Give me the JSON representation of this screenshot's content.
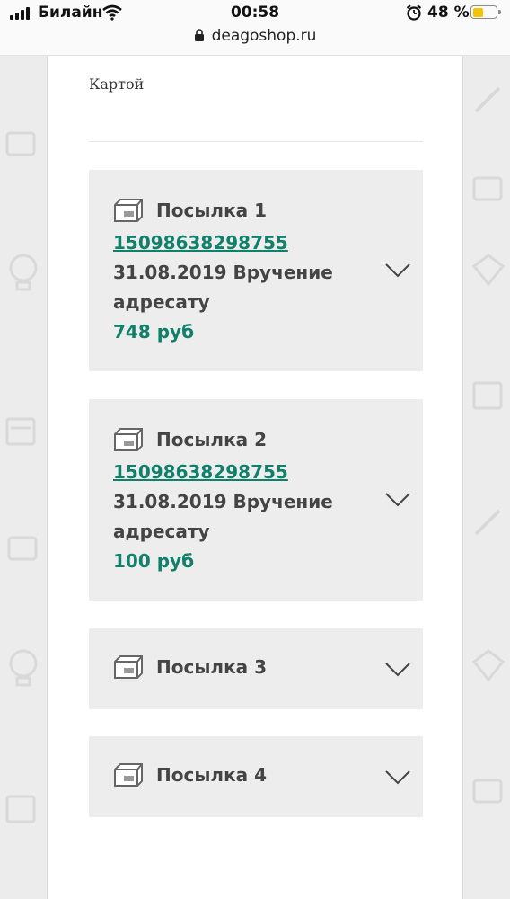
{
  "status_bar": {
    "carrier": "Билайн",
    "time": "00:58",
    "battery_percent": "48 %",
    "battery_level": 0.48,
    "url": "deagoshop.ru"
  },
  "payment": {
    "method_label": "Картой"
  },
  "parcels": [
    {
      "title": "Посылка 1",
      "tracking": "15098638298755",
      "status_line1": "31.08.2019 Вручение",
      "status_line2": "адресату",
      "price": "748 руб",
      "expanded": true
    },
    {
      "title": "Посылка 2",
      "tracking": "15098638298755",
      "status_line1": "31.08.2019 Вручение",
      "status_line2": "адресату",
      "price": "100 руб",
      "expanded": true
    },
    {
      "title": "Посылка 3",
      "expanded": false
    },
    {
      "title": "Посылка 4",
      "expanded": false
    }
  ],
  "icons": {
    "parcel": "parcel-box-icon",
    "expand": "chevron-down-icon",
    "lock": "lock-icon",
    "wifi": "wifi-icon",
    "alarm": "alarm-icon"
  },
  "colors": {
    "accent": "#11806a",
    "card_bg": "#ededed",
    "page_bg": "#ececec",
    "battery": "#f5c400"
  }
}
